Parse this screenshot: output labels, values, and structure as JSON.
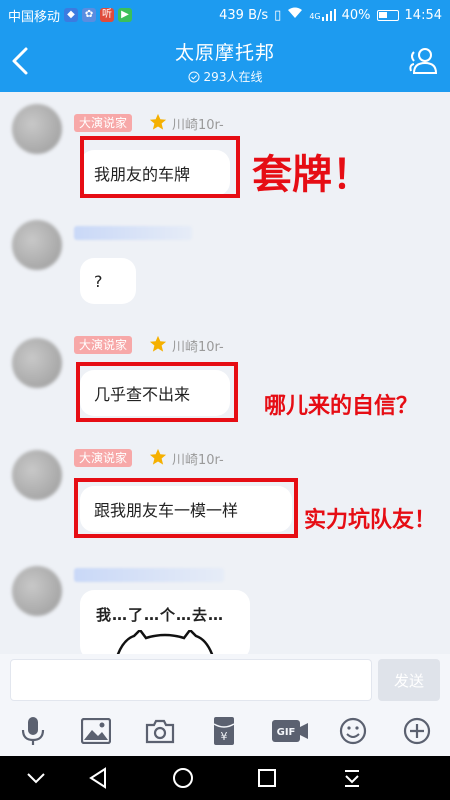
{
  "status_bar": {
    "carrier": "中国移动",
    "network_speed": "439 B/s",
    "signal_label": "4G",
    "battery": "40%",
    "time": "14:54",
    "notif_icons": [
      "shield-icon",
      "app-icon",
      "listen-icon",
      "video-icon"
    ]
  },
  "header": {
    "title": "太原摩托邦",
    "online": "293人在线",
    "back_icon": "back-arrow-icon",
    "members_icon": "group-members-icon"
  },
  "messages": [
    {
      "badge": "大演说家",
      "name": "川崎10r-",
      "text": "我朋友的车牌",
      "annotation": "套牌！"
    },
    {
      "text": "?"
    },
    {
      "badge": "大演说家",
      "name": "川崎10r-",
      "text": "几乎查不出来",
      "annotation": "哪儿来的自信？"
    },
    {
      "badge": "大演说家",
      "name": "川崎10r-",
      "text": "跟我朋友车一模一样",
      "annotation": "实力坑队友！"
    },
    {
      "sticker_text": "我…了…个…去…"
    }
  ],
  "input": {
    "placeholder": "",
    "send_label": "发送"
  },
  "toolbar": [
    "mic-icon",
    "image-icon",
    "camera-icon",
    "red-packet-icon",
    "gif-icon",
    "emoji-icon",
    "plus-icon"
  ],
  "nav": [
    "collapse-icon",
    "back-icon",
    "home-icon",
    "recents-icon",
    "notification-pull-icon"
  ],
  "colors": {
    "primary": "#1d9bf0",
    "annotation_red": "#e60d14",
    "badge": "#f7a8a8"
  }
}
